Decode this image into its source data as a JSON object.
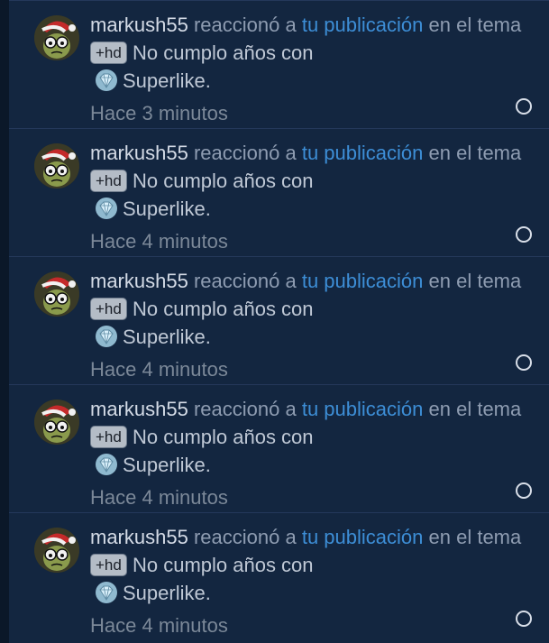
{
  "notifications": [
    {
      "user": "markush55",
      "action": "reaccionó a",
      "link": "tu publicación",
      "in_thread": "en el tema",
      "tag": "+hd",
      "title": "No cumplo años con",
      "reaction": "Superlike.",
      "time": "Hace 3 minutos"
    },
    {
      "user": "markush55",
      "action": "reaccionó a",
      "link": "tu publicación",
      "in_thread": "en el tema",
      "tag": "+hd",
      "title": "No cumplo años con",
      "reaction": "Superlike.",
      "time": "Hace 4 minutos"
    },
    {
      "user": "markush55",
      "action": "reaccionó a",
      "link": "tu publicación",
      "in_thread": "en el tema",
      "tag": "+hd",
      "title": "No cumplo años con",
      "reaction": "Superlike.",
      "time": "Hace 4 minutos"
    },
    {
      "user": "markush55",
      "action": "reaccionó a",
      "link": "tu publicación",
      "in_thread": "en el tema",
      "tag": "+hd",
      "title": "No cumplo años con",
      "reaction": "Superlike.",
      "time": "Hace 4 minutos"
    },
    {
      "user": "markush55",
      "action": "reaccionó a",
      "link": "tu publicación",
      "in_thread": "en el tema",
      "tag": "+hd",
      "title": "No cumplo años con",
      "reaction": "Superlike.",
      "time": "Hace 4 minutos"
    }
  ],
  "colors": {
    "background": "#132640",
    "link": "#3d8ed6",
    "username": "#d4dbe6",
    "muted": "#8e9cb1"
  },
  "icons": {
    "avatar": "cartoon-avatar-with-santa-hat",
    "reaction": "superlike-diamond-icon",
    "unread": "unread-circle-icon"
  }
}
